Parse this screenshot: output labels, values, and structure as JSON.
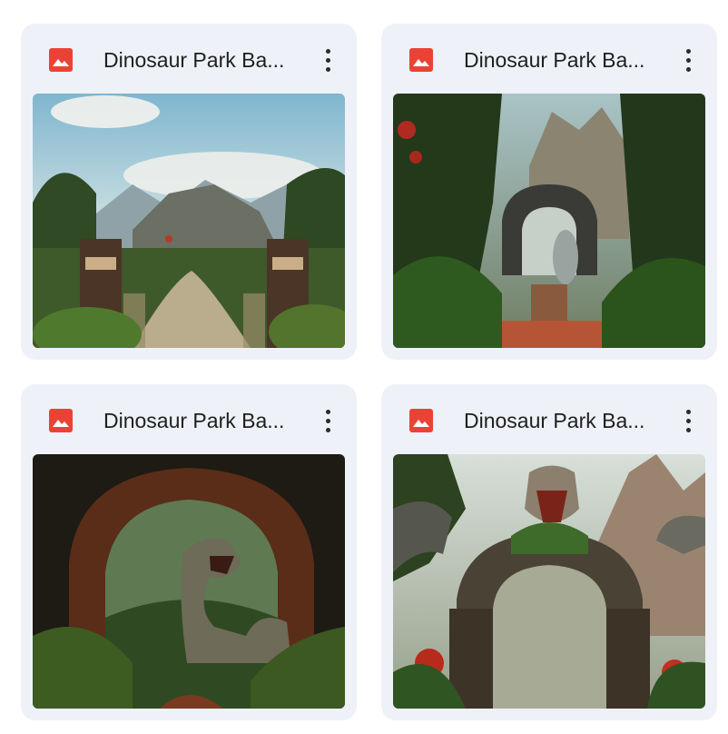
{
  "files": [
    {
      "title": "Dinosaur Park Ba...",
      "icon": "image-file-icon",
      "menu_icon": "more-vert-icon"
    },
    {
      "title": "Dinosaur Park Ba...",
      "icon": "image-file-icon",
      "menu_icon": "more-vert-icon"
    },
    {
      "title": "Dinosaur Park Ba...",
      "icon": "image-file-icon",
      "menu_icon": "more-vert-icon"
    },
    {
      "title": "Dinosaur Park Ba...",
      "icon": "image-file-icon",
      "menu_icon": "more-vert-icon"
    }
  ],
  "colors": {
    "card_background": "#eef1f7",
    "image_icon": "#ea4335",
    "title_text": "#1f1f1f"
  }
}
